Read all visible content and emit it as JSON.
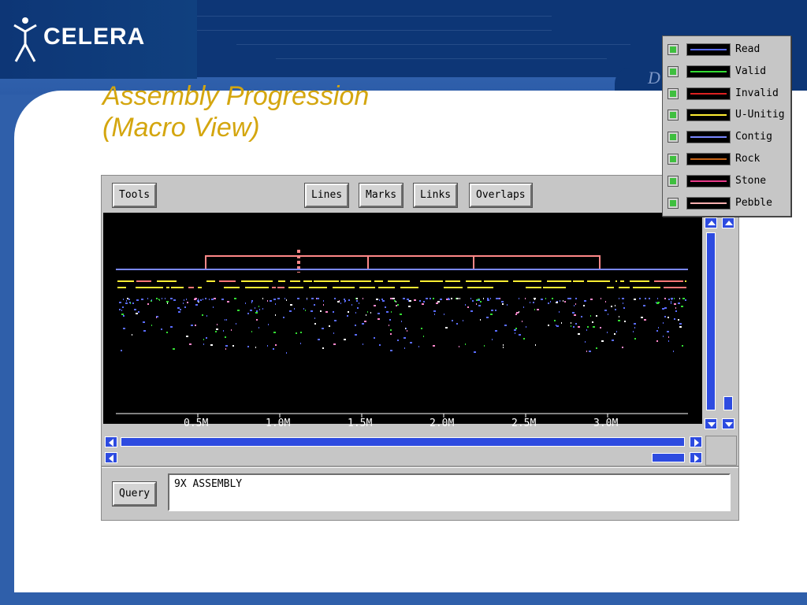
{
  "slide": {
    "brand": "CELERA",
    "title_line1": "Assembly Progression",
    "title_line2": "(Macro View)",
    "header_partial": "D"
  },
  "toolbar": {
    "tools": "Tools",
    "lines": "Lines",
    "marks": "Marks",
    "links": "Links",
    "overlaps": "Overlaps"
  },
  "axis": {
    "ticks": [
      "0.5M",
      "1.0M",
      "1.5M",
      "2.0M",
      "2.5M",
      "3.0M"
    ]
  },
  "query": {
    "button": "Query",
    "value": "9X ASSEMBLY"
  },
  "legend": [
    {
      "label": "Read",
      "color": "#5a6cff",
      "checked": true
    },
    {
      "label": "Valid",
      "color": "#33dd33",
      "checked": true
    },
    {
      "label": "Invalid",
      "color": "#dd2020",
      "checked": true
    },
    {
      "label": "U-Unitig",
      "color": "#ffee33",
      "checked": true
    },
    {
      "label": "Contig",
      "color": "#7a88ff",
      "checked": true
    },
    {
      "label": "Rock",
      "color": "#c86418",
      "checked": true
    },
    {
      "label": "Stone",
      "color": "#e83a8a",
      "checked": true
    },
    {
      "label": "Pebble",
      "color": "#ffb0b0",
      "checked": true
    }
  ]
}
